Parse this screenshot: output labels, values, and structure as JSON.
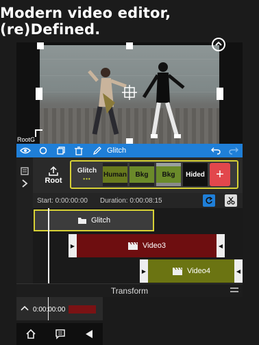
{
  "headline": "Modern video editor, (re)Defined.",
  "preview": {
    "root_label": "Root",
    "root_label_suffix": "G"
  },
  "toolbar": {
    "selected_label": "Glitch",
    "icons": [
      "eye-icon",
      "circle-icon",
      "duplicate-icon",
      "trash-icon",
      "pencil-icon",
      "undo-icon",
      "redo-icon"
    ]
  },
  "layers": {
    "root_label": "Root",
    "chips": [
      {
        "label": "Glitch",
        "dots": "•••",
        "name": "glitch"
      },
      {
        "label": "Human",
        "name": "human"
      },
      {
        "label": "Bkg",
        "name": "bkg1"
      },
      {
        "label": "Bkg",
        "name": "bkg2"
      },
      {
        "label": "Hided",
        "name": "hided"
      }
    ],
    "add_label": "+"
  },
  "info": {
    "start": "Start: 0:00:00:00",
    "duration": "Duration: 0:00:08:15"
  },
  "tracks": {
    "glitch_label": "Glitch",
    "video3_label": "Video3",
    "video4_label": "Video4"
  },
  "transform": {
    "label": "Transform"
  },
  "mini_timeline": {
    "time": "0:00:00:00"
  },
  "colors": {
    "accent_blue": "#1f7fd8",
    "selection_yellow": "#d8d235",
    "add_red": "#e2474c",
    "video3_red": "#6e0e10",
    "video4_olive": "#6b7412"
  }
}
